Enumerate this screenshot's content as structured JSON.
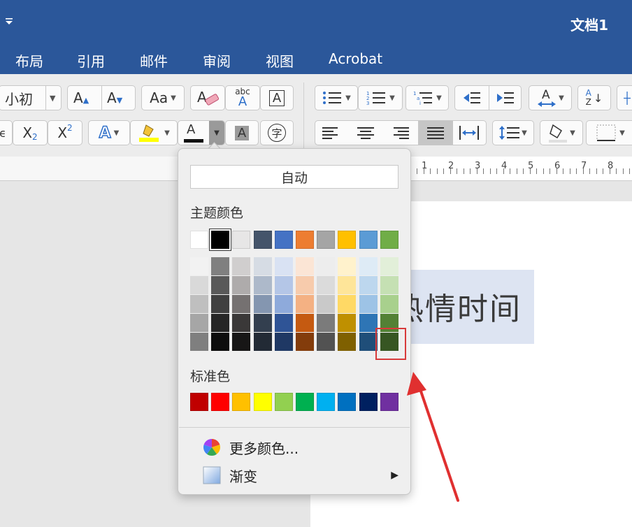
{
  "window": {
    "title": "文档1"
  },
  "ribbon": {
    "tabs": [
      "布局",
      "引用",
      "邮件",
      "审阅",
      "视图",
      "Acrobat"
    ]
  },
  "toolbar": {
    "font_size_value": "小初",
    "grow_font_label": "A",
    "shrink_font_label": "A",
    "change_case_label": "Aa",
    "spell_label": "abc",
    "spell_sub": "A",
    "char_border_label": "A",
    "subscript_base": "X",
    "subscript_sub": "2",
    "superscript_base": "X",
    "superscript_sup": "2",
    "text_effects_label": "A",
    "font_color_label": "A",
    "char_shading_label": "A",
    "enclose_char_label": "字",
    "sort_label_top": "A",
    "sort_label_bottom": "Z",
    "font_color_bar": "#111111"
  },
  "ruler": {
    "numbers": [
      "1",
      "2",
      "3",
      "4",
      "5",
      "6",
      "7",
      "8"
    ]
  },
  "document": {
    "text": "热情时间"
  },
  "color_menu": {
    "auto_label": "自动",
    "theme_label": "主题颜色",
    "standard_label": "标准色",
    "more_colors_label": "更多颜色...",
    "gradient_label": "渐变",
    "theme_colors": [
      "#ffffff",
      "#000000",
      "#e7e6e6",
      "#44546a",
      "#4472c4",
      "#ed7d31",
      "#a5a5a5",
      "#ffc000",
      "#5b9bd5",
      "#70ad47"
    ],
    "theme_shades": [
      [
        "#f2f2f2",
        "#d9d9d9",
        "#bfbfbf",
        "#a6a6a6",
        "#7f7f7f"
      ],
      [
        "#808080",
        "#595959",
        "#404040",
        "#262626",
        "#0d0d0d"
      ],
      [
        "#d0cece",
        "#aeabab",
        "#757171",
        "#3a3838",
        "#171616"
      ],
      [
        "#d6dce4",
        "#adb9ca",
        "#8496b0",
        "#333f4f",
        "#222a35"
      ],
      [
        "#d9e2f3",
        "#b4c6e7",
        "#8eaadb",
        "#2f5496",
        "#1f3864"
      ],
      [
        "#fbe5d5",
        "#f7cbac",
        "#f4b183",
        "#c55a11",
        "#833c0b"
      ],
      [
        "#ededed",
        "#dbdbdb",
        "#c9c9c9",
        "#7b7b7b",
        "#525252"
      ],
      [
        "#fff2cc",
        "#fee599",
        "#ffd965",
        "#bf9000",
        "#7f6000"
      ],
      [
        "#deebf6",
        "#bdd7ee",
        "#9dc3e6",
        "#2e75b5",
        "#1f4e79"
      ],
      [
        "#e2efd9",
        "#c5e0b3",
        "#a8d08d",
        "#538135",
        "#375623"
      ]
    ],
    "standard_colors": [
      "#c00000",
      "#ff0000",
      "#ffc000",
      "#ffff00",
      "#92d050",
      "#00b050",
      "#00b0f0",
      "#0070c0",
      "#002060",
      "#7030a0"
    ],
    "selected_theme_color": "#000000",
    "highlighted_shade": "#375623"
  },
  "annotation": {
    "arrow_color": "#e03030"
  }
}
